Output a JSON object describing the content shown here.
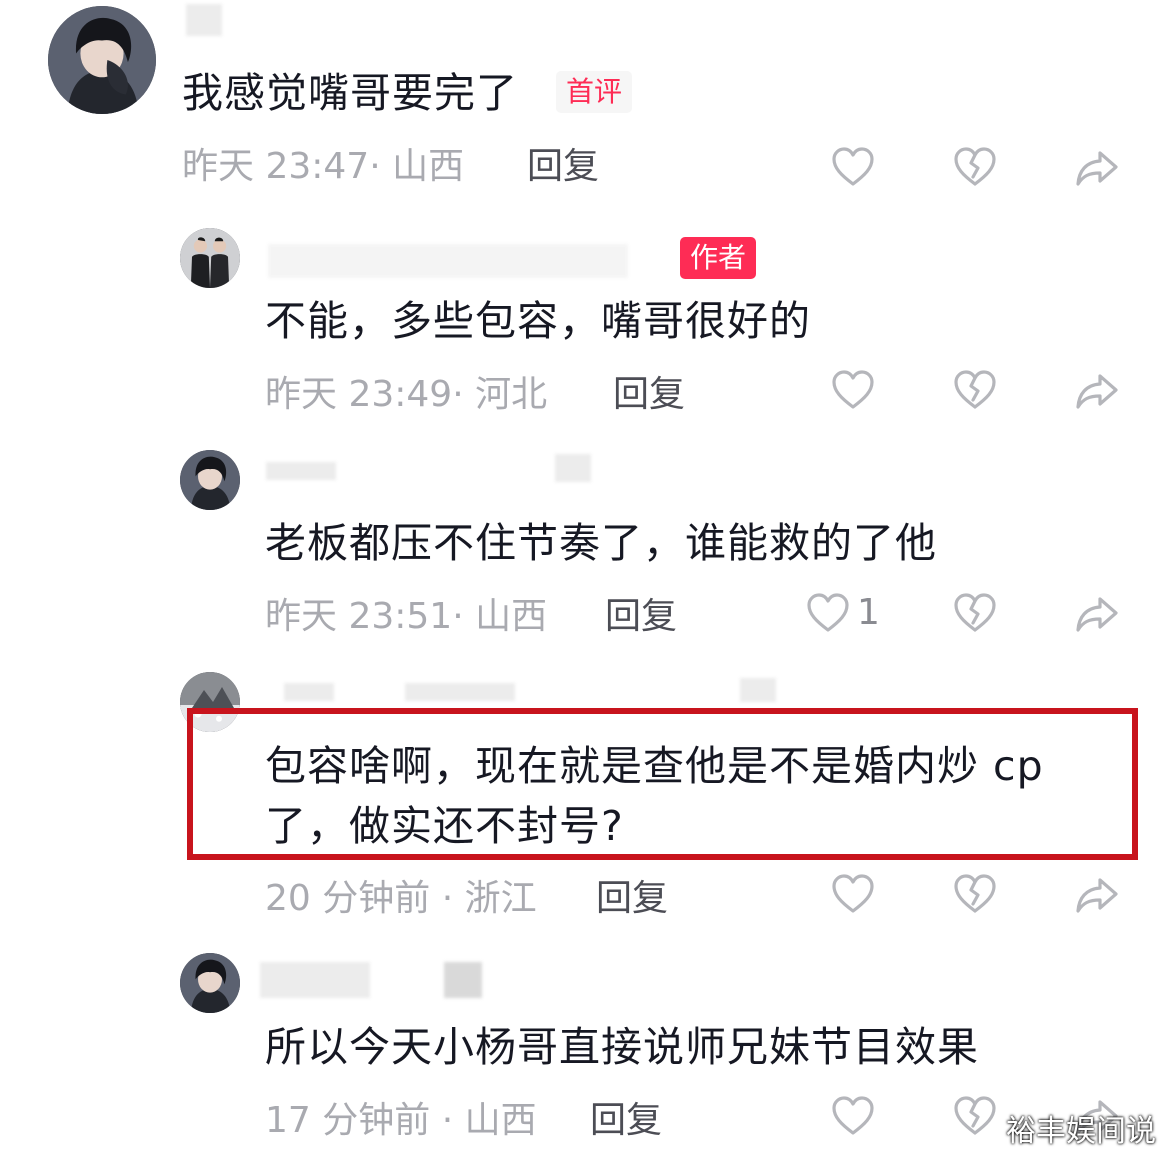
{
  "comments": [
    {
      "text": "我感觉嘴哥要完了",
      "badge": "首评",
      "meta": "昨天 23:47· 山西",
      "reply": "回复",
      "avatar_icon": "anime-boy-avatar-icon"
    },
    {
      "text": "不能，多些包容，嘴哥很好的",
      "badge": "作者",
      "meta": "昨天 23:49· 河北",
      "reply": "回复",
      "avatar_icon": "two-men-avatar-icon"
    },
    {
      "text": "老板都压不住节奏了，谁能救的了他",
      "meta": "昨天 23:51· 山西",
      "reply": "回复",
      "like_count": "1",
      "avatar_icon": "anime-boy-avatar-icon"
    },
    {
      "text_line1": "包容啥啊，现在就是查他是不是婚内炒 cp",
      "text_line2": "了，做实还不封号?",
      "meta": "20 分钟前 · 浙江",
      "reply": "回复",
      "avatar_icon": "snowy-photo-avatar-icon"
    },
    {
      "text": "所以今天小杨哥直接说师兄妹节目效果",
      "meta": "17 分钟前 · 山西",
      "reply": "回复",
      "avatar_icon": "anime-boy-avatar-icon"
    }
  ],
  "watermark": "裕丰娱间说",
  "colors": {
    "accent": "#fe2c55",
    "highlight_border": "#c8141d",
    "meta_text": "#a9aab0",
    "icon_gray": "#b5b6bb"
  }
}
